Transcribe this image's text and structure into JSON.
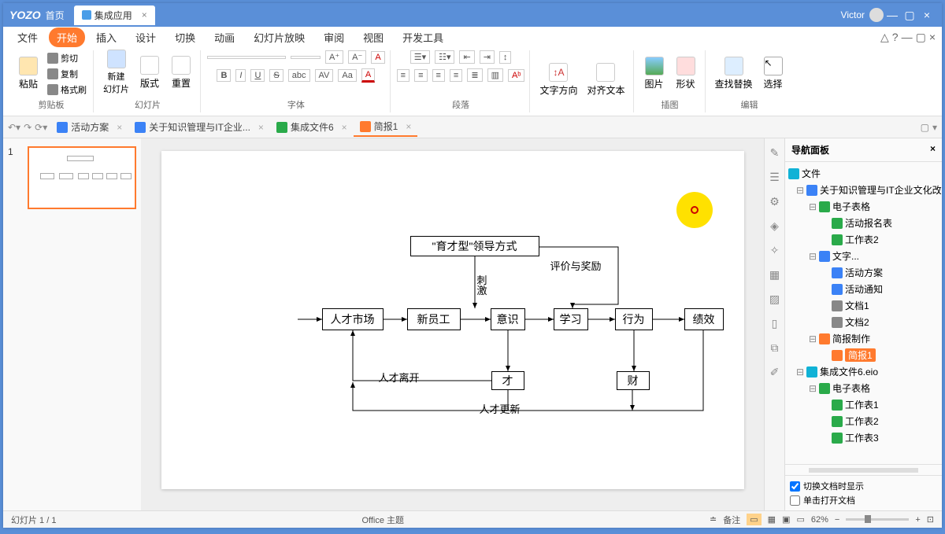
{
  "titlebar": {
    "logo": "YOZO",
    "home": "首页",
    "tab": "集成应用",
    "user": "Victor"
  },
  "menu": {
    "file": "文件",
    "items": [
      "开始",
      "插入",
      "设计",
      "切换",
      "动画",
      "幻灯片放映",
      "审阅",
      "视图",
      "开发工具"
    ]
  },
  "ribbon": {
    "clipboard": {
      "paste": "粘贴",
      "cut": "剪切",
      "copy": "复制",
      "format": "格式刷",
      "label": "剪贴板"
    },
    "slides": {
      "new": "新建\n幻灯片",
      "layout": "版式",
      "reset": "重置",
      "label": "幻灯片"
    },
    "font": {
      "bold": "B",
      "italic": "I",
      "underline": "U",
      "strike": "S",
      "shadow": "abc",
      "spacing": "AV",
      "case": "Aa",
      "color": "A",
      "bigA": "A⁺",
      "smallA": "A⁻",
      "ax": "A",
      "label": "字体"
    },
    "para": {
      "label": "段落"
    },
    "textdir": {
      "dir": "文字方向",
      "align": "对齐文本"
    },
    "insert": {
      "pic": "图片",
      "shape": "形状",
      "label": "插图"
    },
    "edit": {
      "find": "查找替换",
      "select": "选择",
      "label": "编辑"
    }
  },
  "doctabs": [
    {
      "label": "活动方案",
      "icon": "ic-blue"
    },
    {
      "label": "关于知识管理与IT企业...",
      "icon": "ic-blue"
    },
    {
      "label": "集成文件6",
      "icon": "ic-green"
    },
    {
      "label": "简报1",
      "icon": "ic-orange",
      "active": true
    }
  ],
  "diagram": {
    "b1": "\"育才型\"领导方式",
    "b2": "人才市场",
    "b3": "新员工",
    "b4": "意识",
    "b5": "学习",
    "b6": "行为",
    "b7": "绩效",
    "b8": "才",
    "b9": "财",
    "l_eval": "评价与奖励",
    "l_stim": "刺\n激",
    "l_leave": "人才离开",
    "l_update": "人才更新"
  },
  "nav": {
    "title": "导航面板",
    "root": "文件",
    "tree": [
      {
        "t": "关于知识管理与IT企业文化改革",
        "d": 0,
        "c": "ic-blue"
      },
      {
        "t": "电子表格",
        "d": 1,
        "c": "ic-green"
      },
      {
        "t": "活动报名表",
        "d": 2,
        "c": "ic-green"
      },
      {
        "t": "工作表2",
        "d": 2,
        "c": "ic-green"
      },
      {
        "t": "文字...",
        "d": 1,
        "c": "ic-blue"
      },
      {
        "t": "活动方案",
        "d": 2,
        "c": "ic-blue"
      },
      {
        "t": "活动通知",
        "d": 2,
        "c": "ic-blue"
      },
      {
        "t": "文档1",
        "d": 2,
        "c": "ic-gray"
      },
      {
        "t": "文档2",
        "d": 2,
        "c": "ic-gray"
      },
      {
        "t": "简报制作",
        "d": 1,
        "c": "ic-orange"
      },
      {
        "t": "简报1",
        "d": 2,
        "c": "ic-orange",
        "sel": true
      },
      {
        "t": "集成文件6.eio",
        "d": 0,
        "c": "ic-cyan"
      },
      {
        "t": "电子表格",
        "d": 1,
        "c": "ic-green"
      },
      {
        "t": "工作表1",
        "d": 2,
        "c": "ic-green"
      },
      {
        "t": "工作表2",
        "d": 2,
        "c": "ic-green"
      },
      {
        "t": "工作表3",
        "d": 2,
        "c": "ic-green"
      }
    ],
    "opt1": "切换文档时显示",
    "opt2": "单击打开文档"
  },
  "status": {
    "slide": "幻灯片 1 / 1",
    "theme": "Office 主题",
    "notes": "备注",
    "zoom": "62%"
  },
  "thumb_num": "1"
}
